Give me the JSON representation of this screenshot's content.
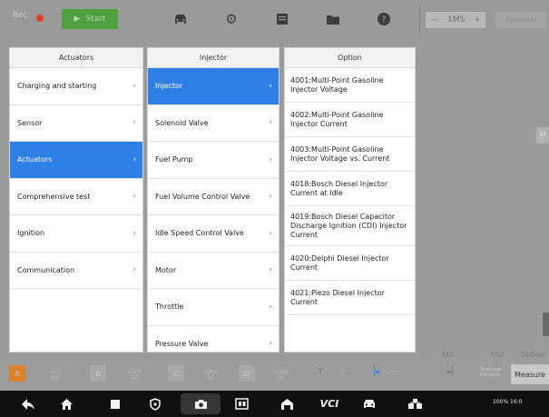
{
  "toolbar": {
    "recording_label": "Rec",
    "start_label": "Start",
    "start_icon": "play-icon",
    "icons": [
      "car-icon",
      "gear-icon",
      "display-icon",
      "folder-icon",
      "help-icon"
    ],
    "timebase": {
      "minus": "—",
      "value": "1MS",
      "plus": "+"
    },
    "autoscale_label": "AutoScale"
  },
  "background": {
    "side_badge": "M",
    "axis_labels": [
      "400",
      "450",
      "500ms"
    ]
  },
  "panels": {
    "category": {
      "title": "Actuators",
      "items": [
        {
          "label": "Charging and starting"
        },
        {
          "label": "Sensor"
        },
        {
          "label": "Actuators",
          "selected": true
        },
        {
          "label": "Comprehensive test"
        },
        {
          "label": "Ignition"
        },
        {
          "label": "Communication"
        }
      ]
    },
    "component": {
      "title": "Injector",
      "items": [
        {
          "label": "Injector",
          "selected": true
        },
        {
          "label": "Solenoid Valve"
        },
        {
          "label": "Fuel Pump"
        },
        {
          "label": "Fuel Volume Control Valve"
        },
        {
          "label": "Idle Speed Control Valve"
        },
        {
          "label": "Motor"
        },
        {
          "label": "Throttle"
        },
        {
          "label": "Pressure Valve"
        }
      ]
    },
    "option": {
      "title": "Option",
      "items": [
        {
          "label": "4001:Multi-Point Gasoline Injector Voltage"
        },
        {
          "label": "4002:Multi-Point Gasoline Injector Current"
        },
        {
          "label": "4003:Multi-Point Gasoline Injector Voltage vs. Current"
        },
        {
          "label": "4018:Bosch Diesel Injector Current at Idle"
        },
        {
          "label": "4019:Bosch Diesel Capacitor Discharge Ignition (CDI) Injector Current"
        },
        {
          "label": "4020:Delphi Diesel Injector Current"
        },
        {
          "label": "4021:Piezo Diesel Injector Current"
        }
      ]
    }
  },
  "channel_bar": {
    "channels": [
      {
        "badge": "A",
        "range": "±5V",
        "coupling": "DC",
        "color": "#d9822b"
      },
      {
        "badge": "B",
        "range": "±20V",
        "coupling": "DC",
        "color": "#a8a8a8"
      },
      {
        "badge": "C",
        "range": "±20V",
        "coupling": "DC",
        "color": "#a8a8a8"
      },
      {
        "badge": "D",
        "range": "±20V",
        "coupling": "DC",
        "color": "#a8a8a8"
      }
    ],
    "page_indicator": "1/32",
    "timebase_line1": "Timebase",
    "timebase_line2": "50ms/div",
    "measure_label": "Measure"
  },
  "system_bar": {
    "icons": [
      "back-icon",
      "home-icon",
      "recents-icon",
      "shield-icon",
      "camera-icon",
      "screen-record-icon",
      "garage-icon",
      "vci-icon",
      "car-icon",
      "network-icon"
    ],
    "vci_label": "VCI",
    "status_text": "100% 16:0"
  },
  "colors": {
    "accent": "#2f80e6",
    "start_green": "#4f9e3f",
    "channel_a_orange": "#d9822b"
  }
}
